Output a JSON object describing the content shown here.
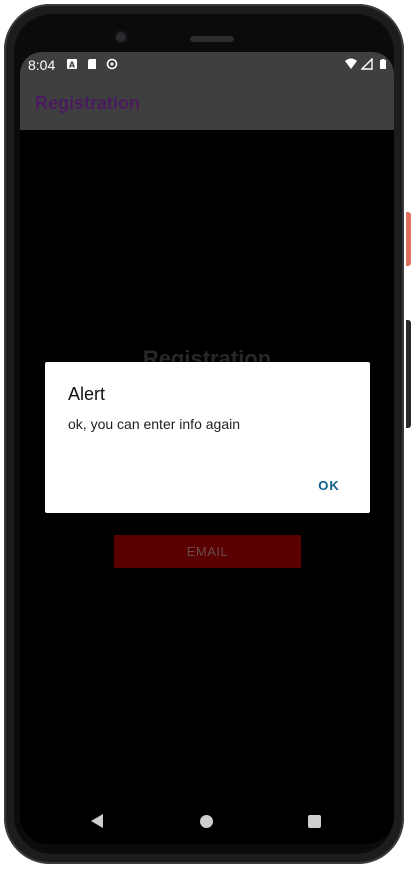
{
  "status_bar": {
    "time": "8:04",
    "icons": [
      "accessibility-a-icon",
      "sd-card-icon",
      "sync-icon",
      "wifi-icon",
      "cell-signal-icon",
      "battery-icon"
    ]
  },
  "app_bar": {
    "title": "Registration",
    "title_color": "#4a1a5e"
  },
  "main": {
    "heading": "Registration",
    "email_button_label": "EMAIL",
    "email_button_color": "#5a0000"
  },
  "dialog": {
    "title": "Alert",
    "message": "ok, you can enter info again",
    "ok_label": "OK",
    "ok_color": "#0e5f8a"
  },
  "nav_bar": {
    "icons": [
      "back-icon",
      "home-icon",
      "recents-icon"
    ]
  }
}
